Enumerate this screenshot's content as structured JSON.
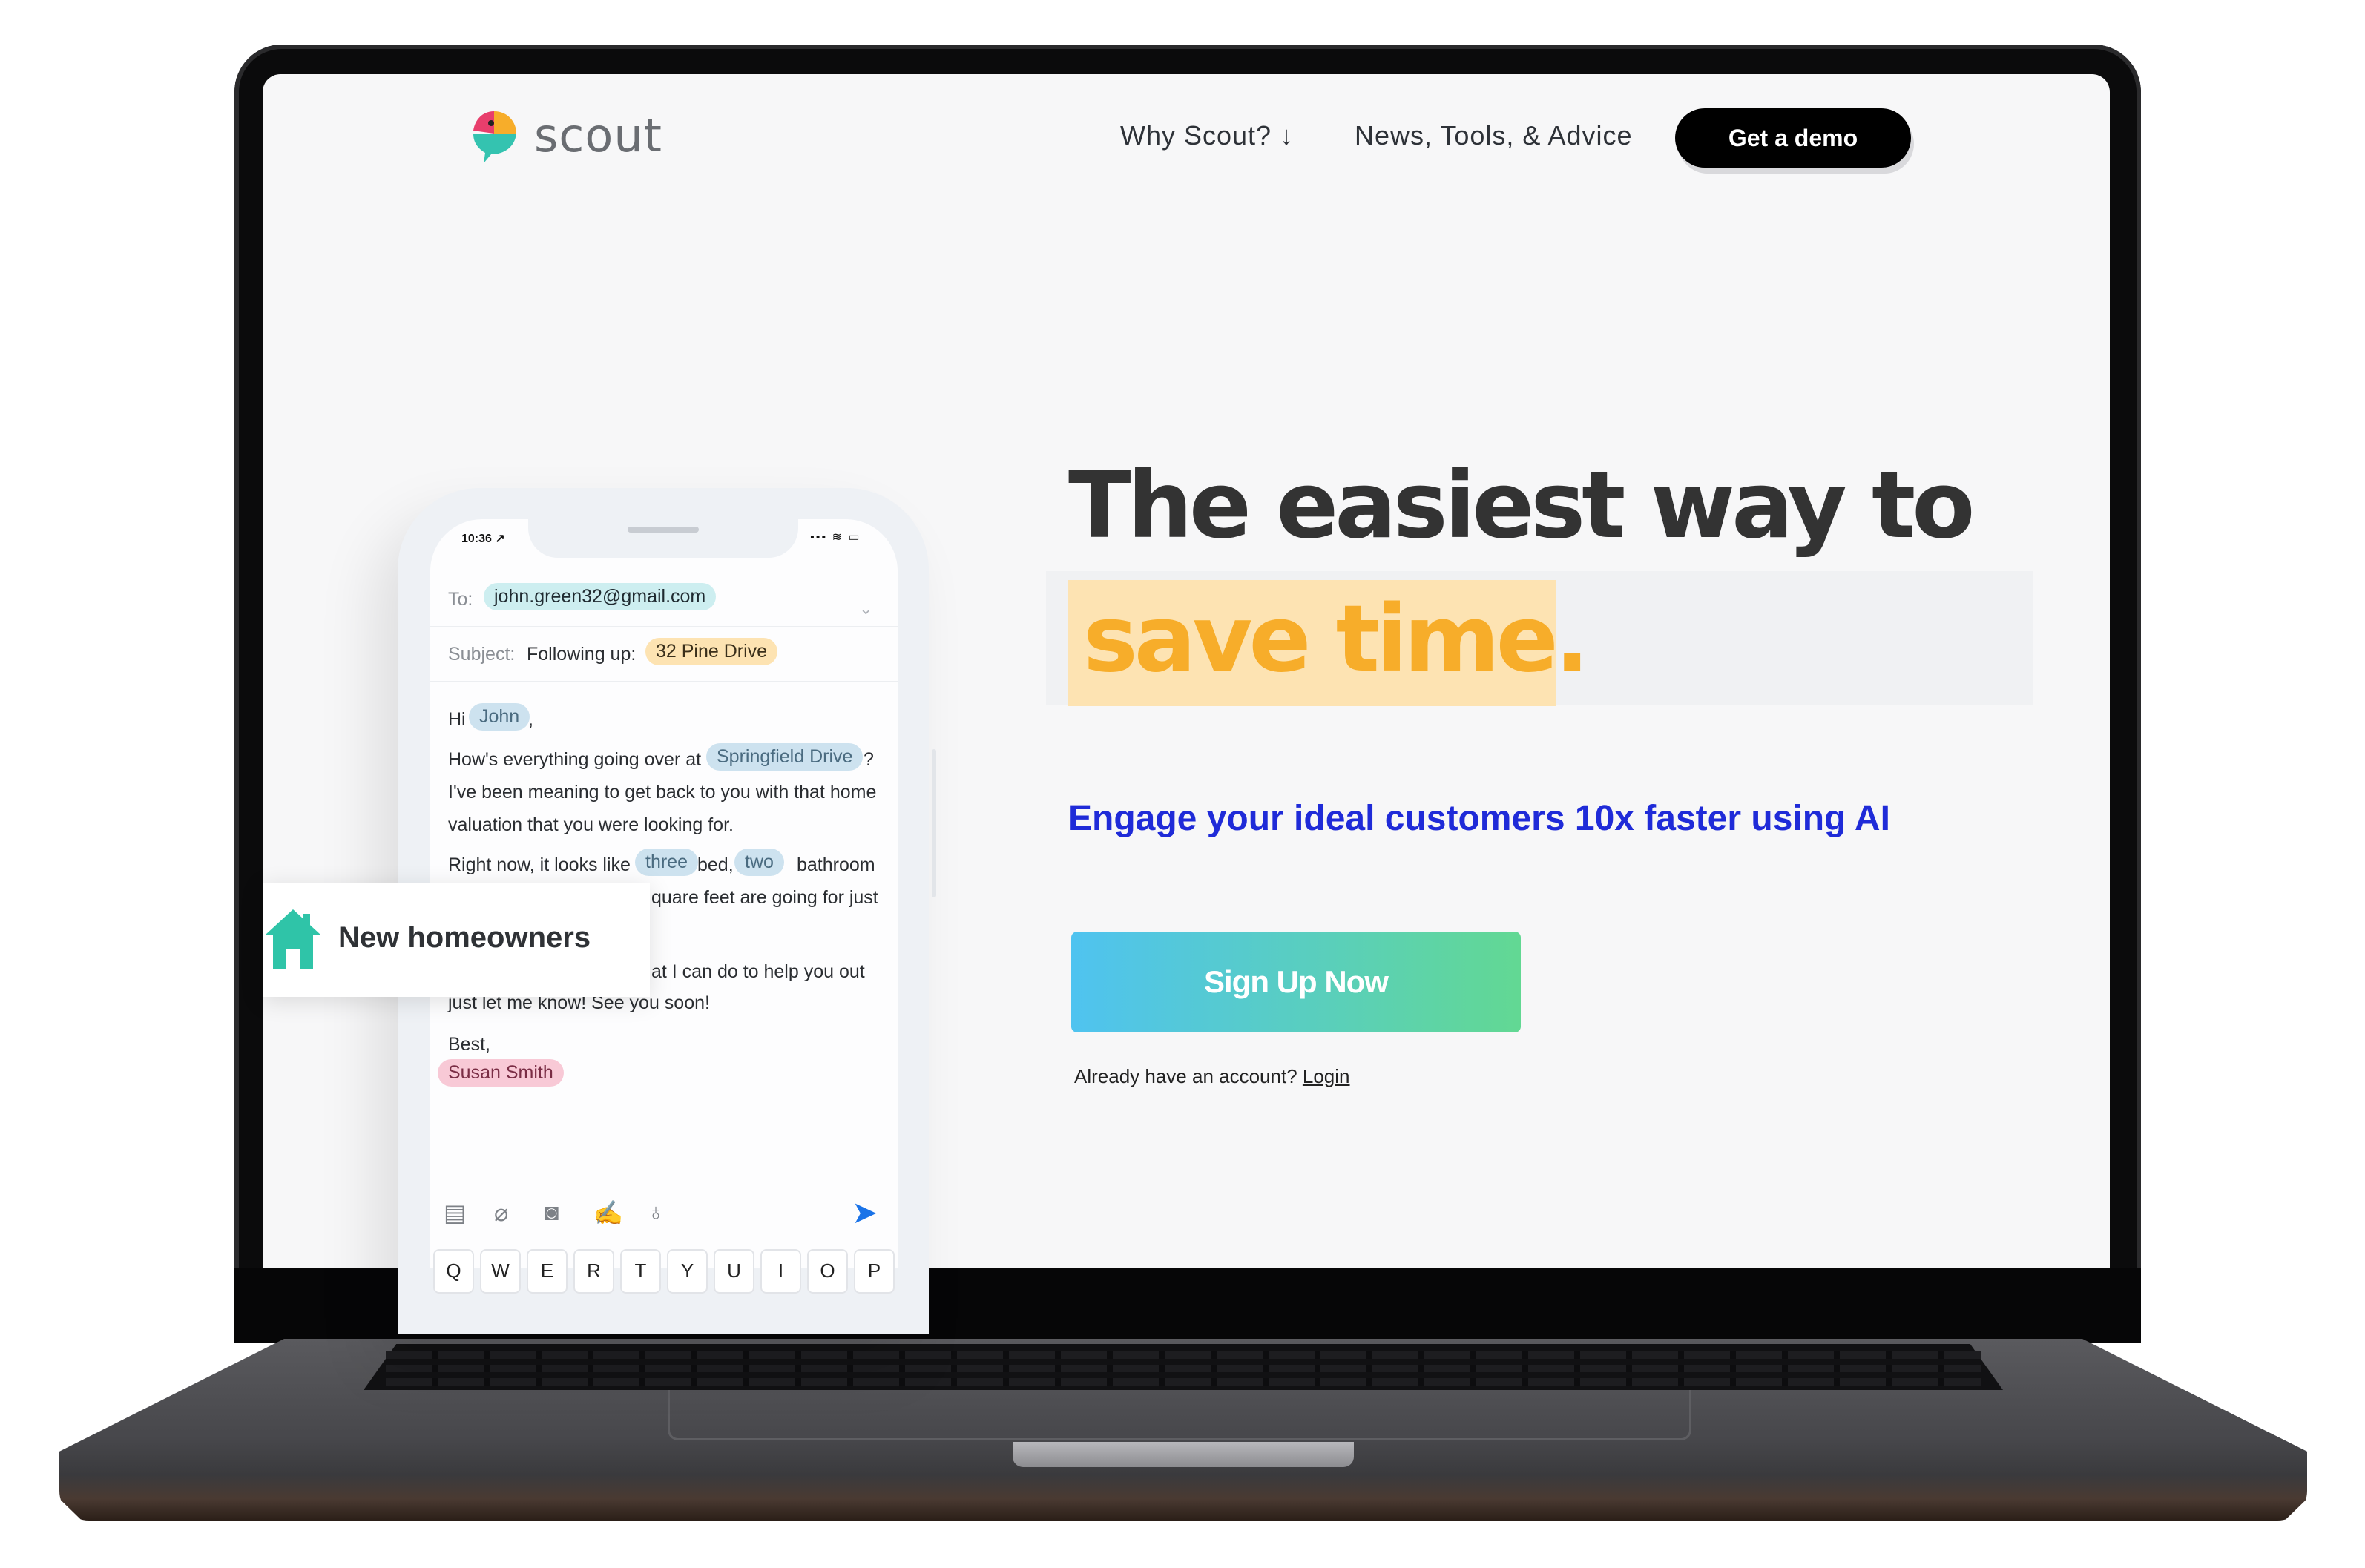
{
  "brand": {
    "name": "scout",
    "colors": {
      "accent_yellow": "#f7ad2a",
      "accent_blue": "#1f2bd8",
      "button_start": "#4fc3f0",
      "button_end": "#62d893"
    }
  },
  "nav": {
    "why": "Why Scout? ↓",
    "news": "News, Tools, & Advice",
    "demo": "Get a demo"
  },
  "hero": {
    "headline": "The easiest way to",
    "headline_accent": "save time.",
    "subheadline": "Engage your ideal customers 10x faster using AI",
    "signup": "Sign Up Now",
    "account_prompt": "Already have an account?",
    "login": "Login"
  },
  "phone": {
    "status_time": "10:36 ↗",
    "status_icons": "▪▪▪ ≋ ▭",
    "to_label": "To:",
    "to_value": "john.green32@gmail.com",
    "subject_label": "Subject:",
    "subject_text": "Following up:",
    "subject_chip": "32 Pine Drive",
    "greeting": "Hi",
    "greeting_name": "John",
    "greeting_comma": ",",
    "line1": "How's everything going over at",
    "line1_chip": "Springfield Drive",
    "line1_end": "?",
    "line2": "I've been meaning to get back to you with that home",
    "line3": "valuation that you were looking for.",
    "line4_start": "Right now, it looks like",
    "line4_chip1": "three",
    "line4_mid": "bed,",
    "line4_chip2": "two",
    "line4_end": "bathroom",
    "line5_visible": "quare feet are going for just",
    "line6_visible": "at I can do to help you out",
    "line7": "just let me know! See you soon!",
    "signoff": "Best,",
    "sender": "Susan Smith",
    "keyboard_row": [
      "Q",
      "W",
      "E",
      "R",
      "T",
      "Y",
      "U",
      "I",
      "O",
      "P"
    ],
    "toolbar_icons": [
      "calendar-icon",
      "paperclip-icon",
      "camera-icon",
      "signature-icon",
      "microphone-icon"
    ]
  },
  "overlay": {
    "label": "New homeowners"
  }
}
